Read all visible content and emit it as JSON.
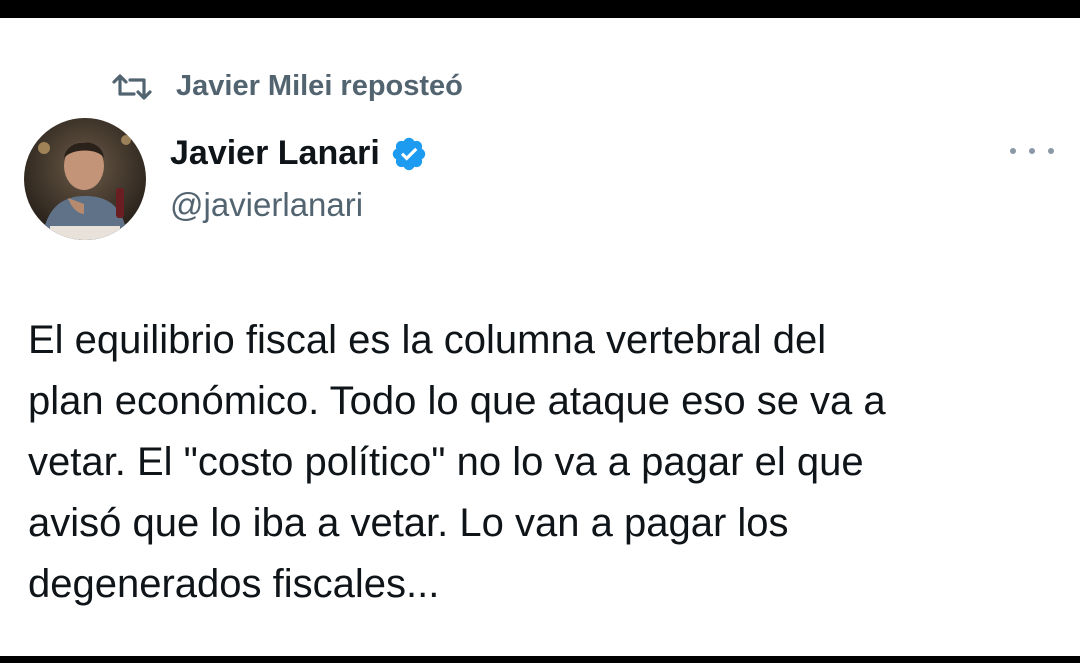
{
  "repost_label": "Javier Milei reposteó",
  "author": {
    "name": "Javier Lanari",
    "handle": "@javierlanari",
    "verified": true
  },
  "tweet": {
    "text": "El equilibrio fiscal es la columna vertebral del\nplan económico. Todo lo que ataque eso se va a\nvetar. El \"costo político\" no lo va a pagar el que\navisó que lo iba a vetar. Lo van a pagar los\ndegenerados fiscales..."
  },
  "icons": {
    "repost": "repost-icon",
    "verified": "verified-badge-icon",
    "more": "more-options-icon"
  },
  "colors": {
    "verified_blue": "#1d9bf0",
    "secondary_text": "#536471",
    "primary_text": "#0f1419"
  }
}
